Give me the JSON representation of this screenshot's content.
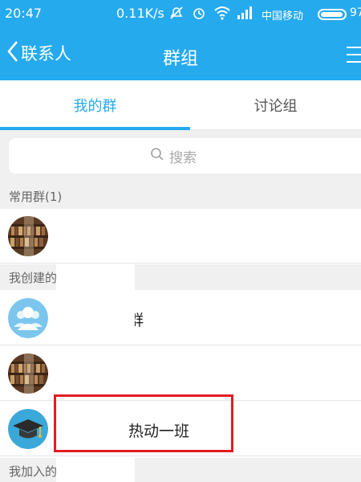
{
  "status_bar": {
    "time": "20:47",
    "speed": "0.11K/s",
    "carrier": "中国移动",
    "battery_text": "97",
    "battery_level": 0.97
  },
  "header": {
    "back_label": "联系人",
    "title": "群组"
  },
  "tabs": [
    {
      "label": "我的群",
      "active": true
    },
    {
      "label": "讨论组",
      "active": false
    }
  ],
  "search": {
    "placeholder": "搜索"
  },
  "sections": {
    "common_groups": "常用群(1)",
    "created_groups": "我创建的",
    "joined_groups": "我加入的"
  },
  "rows": [
    {
      "label": "",
      "avatar": "bookshelf-avatar"
    },
    {
      "label": "群",
      "avatar": "people-avatar"
    },
    {
      "label": "",
      "avatar": "bookshelf-avatar"
    },
    {
      "label": "热动一班",
      "avatar": "graduation-cap-avatar"
    }
  ],
  "colors": {
    "accent": "#25aaee",
    "highlight": "#e21c22",
    "section_bg": "#f0f0f0"
  }
}
